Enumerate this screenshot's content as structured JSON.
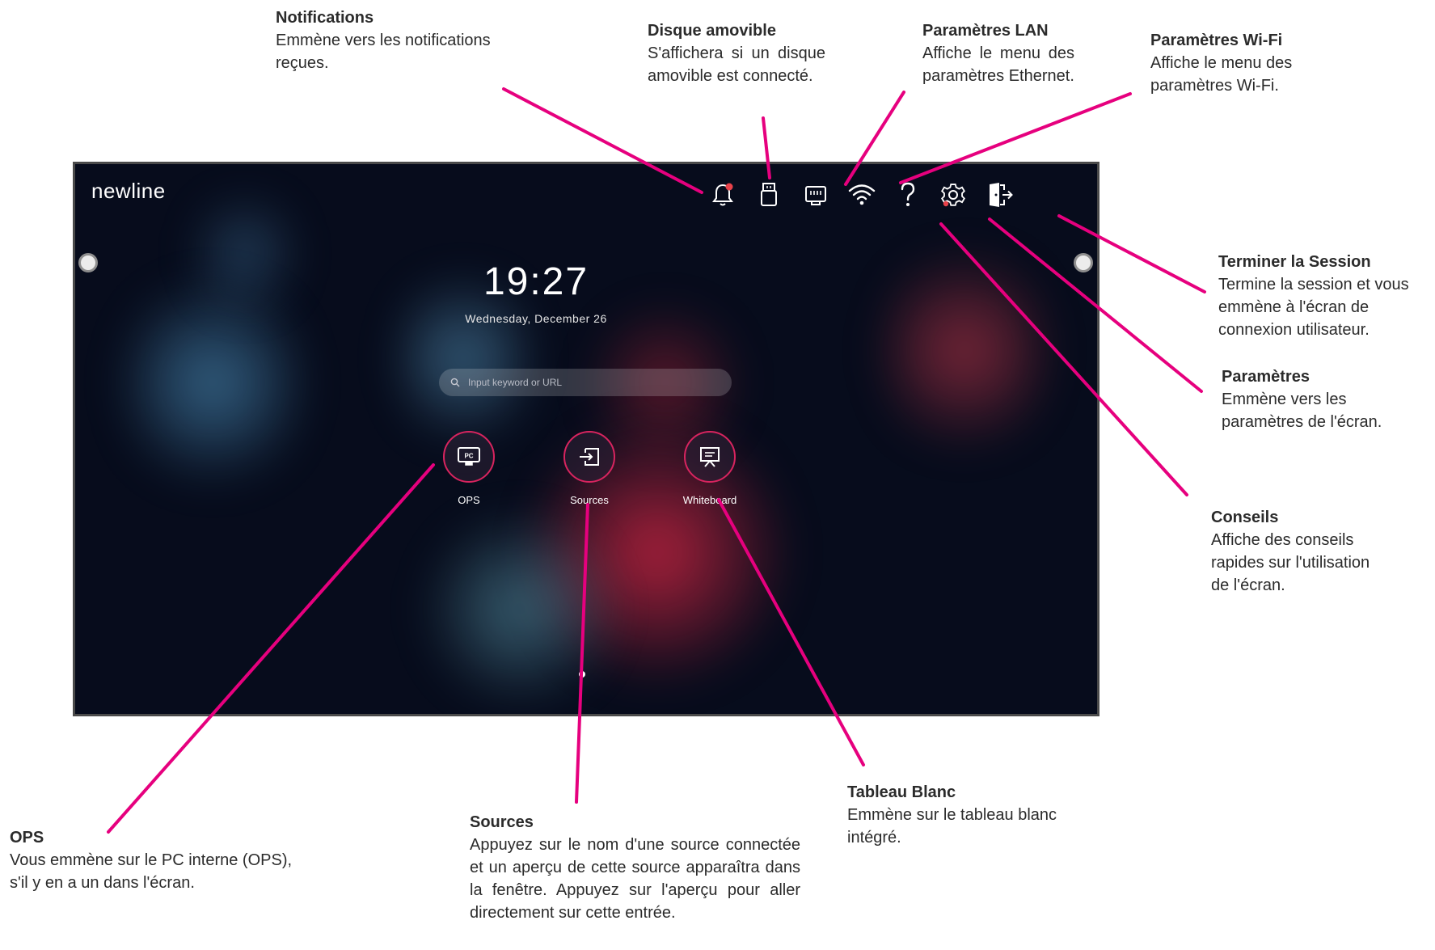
{
  "screen": {
    "brand": "newline",
    "time": "19:27",
    "date": "Wednesday, December 26",
    "search": {
      "placeholder": "Input keyword or URL"
    },
    "top_icons": [
      "bell-icon",
      "usb-drive-icon",
      "ethernet-icon",
      "wifi-icon",
      "question-icon",
      "gear-icon",
      "logout-icon"
    ],
    "apps": [
      {
        "label": "OPS",
        "icon": "pc-monitor-icon",
        "icon_text": "PC"
      },
      {
        "label": "Sources",
        "icon": "input-source-icon"
      },
      {
        "label": "Whiteboard",
        "icon": "whiteboard-icon"
      }
    ]
  },
  "annotations": {
    "notifications": {
      "title": "Notifications",
      "desc": "Emmène vers les notifications reçues."
    },
    "removable_disk": {
      "title": "Disque amovible",
      "desc": "S'affichera si un disque amovible est connecté."
    },
    "lan": {
      "title": "Paramètres LAN",
      "desc": "Affiche le menu des paramètres Ethernet."
    },
    "wifi": {
      "title": "Paramètres Wi-Fi",
      "desc": "Affiche le menu des paramètres Wi-Fi."
    },
    "end_session": {
      "title": "Terminer la Session",
      "desc": "Termine la session et vous emmène à l'écran de connexion utilisateur."
    },
    "settings": {
      "title": "Paramètres",
      "desc": "Emmène vers les paramètres de l'écran."
    },
    "tips": {
      "title": "Conseils",
      "desc": "Affiche des conseils rapides sur l'utilisation de l'écran."
    },
    "ops": {
      "title": "OPS",
      "desc": "Vous emmène sur le PC interne (OPS), s'il y en a un dans l'écran."
    },
    "sources": {
      "title": "Sources",
      "desc": "Appuyez sur le nom d'une source connectée et un aperçu de cette source apparaîtra dans la fenêtre. Appuyez sur l'aperçu pour aller directement sur cette entrée."
    },
    "whiteboard": {
      "title": "Tableau Blanc",
      "desc": "Emmène sur le tableau blanc intégré."
    }
  },
  "colors": {
    "accent": "#e6007e",
    "icon_ring": "#d8245f",
    "notification_dot": "#e8424a"
  }
}
